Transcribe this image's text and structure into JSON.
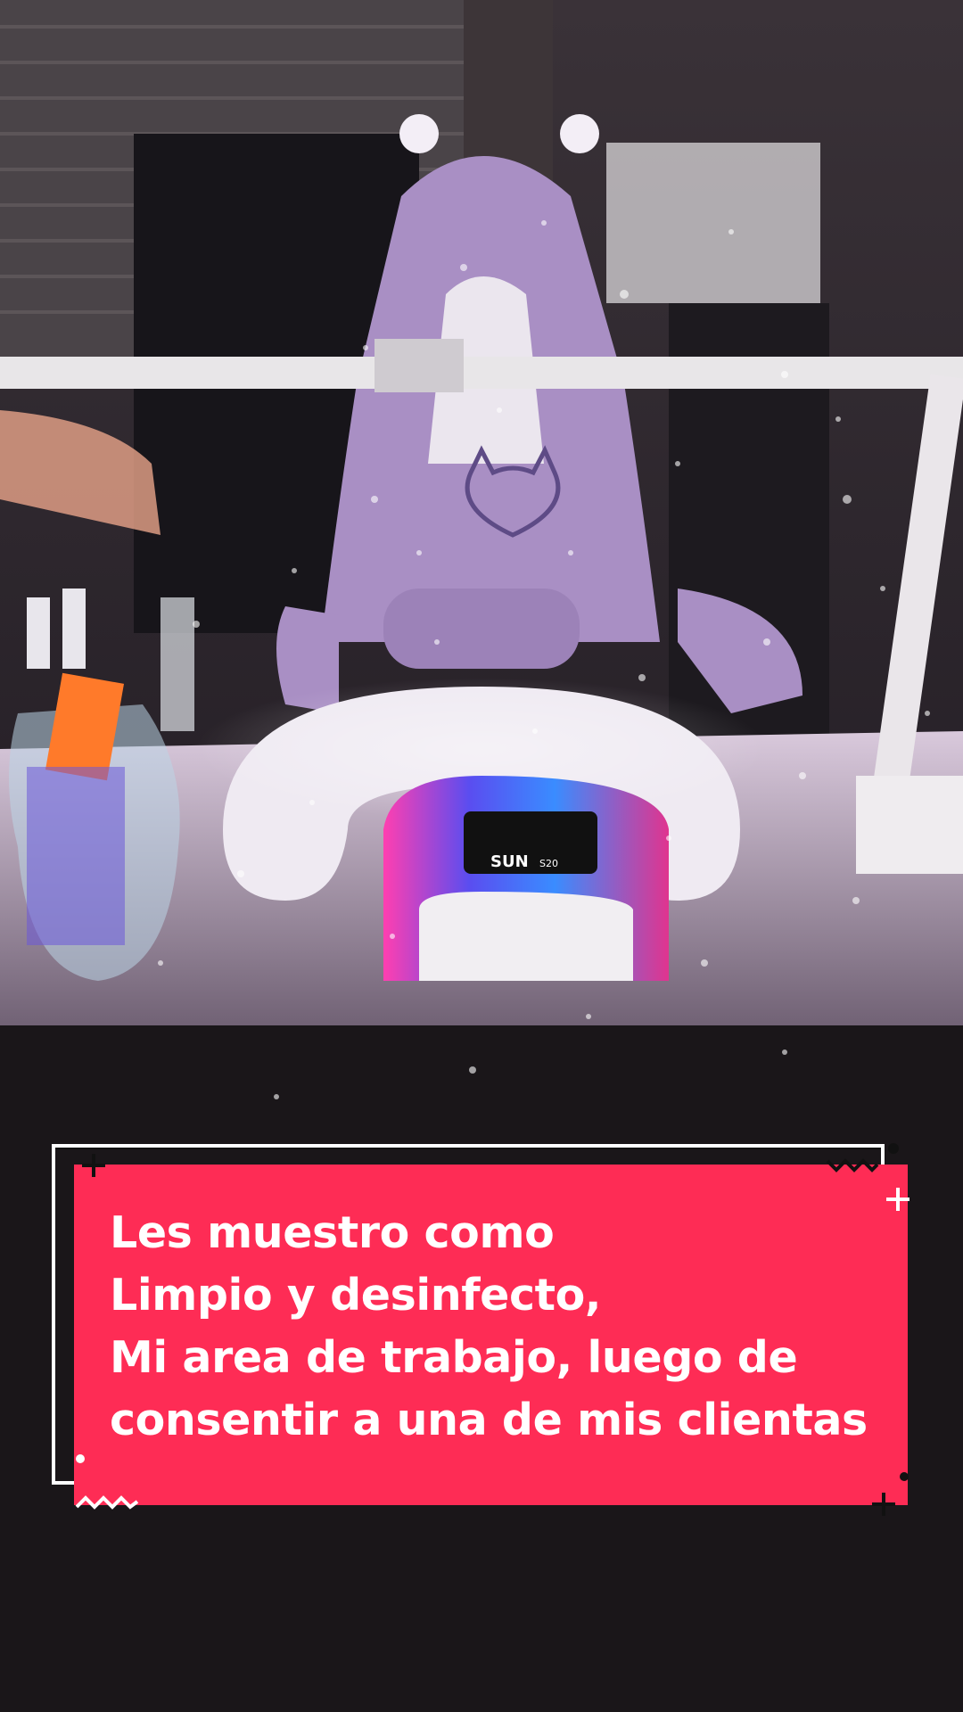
{
  "caption": {
    "lines": [
      "Les muestro como",
      "Limpio y desinfecto,",
      "Mi area de trabajo, luego de",
      "consentir a una de mis clientas"
    ],
    "background_color": "#fe2c55",
    "text_color": "#ffffff"
  },
  "photo": {
    "lamp_brand": "SUN",
    "lamp_model": "S20"
  },
  "icons": [
    "plus-icon",
    "zigzag-icon",
    "dot-icon",
    "sparkle-particles"
  ]
}
